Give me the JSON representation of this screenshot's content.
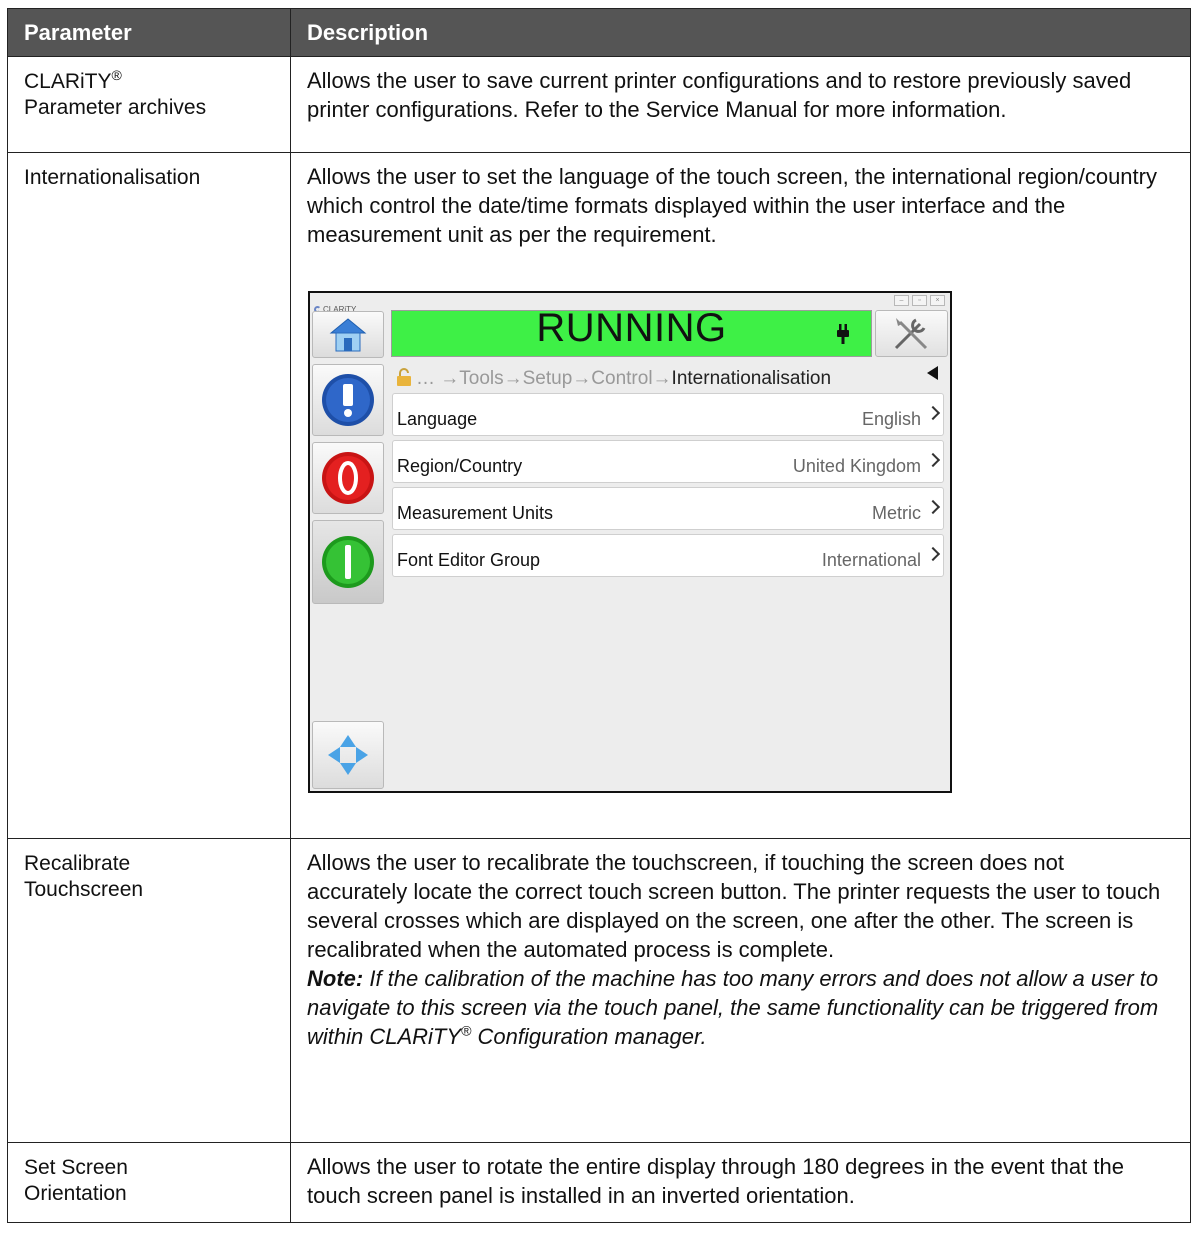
{
  "table": {
    "headers": [
      "Parameter",
      "Description"
    ],
    "rows": {
      "archives": {
        "param_line1": "CLARiTY",
        "param_sup": "®",
        "param_line2": "Parameter archives",
        "desc": "Allows the user to save current printer configurations and to restore previously saved printer configurations. Refer to the Service Manual for more information."
      },
      "intl": {
        "param": "Internationalisation",
        "desc": "Allows the user to set the language of the touch screen, the international region/country which control the date/time formats displayed within the user interface and the measurement unit as per the requirement."
      },
      "recal": {
        "param_line1": "Recalibrate",
        "param_line2": "Touchscreen",
        "desc": "Allows the user to recalibrate the touchscreen, if touching the screen does not accurately locate the correct touch screen button. The printer requests the user to touch several crosses which are displayed on the screen, one after the other. The screen is recalibrated when the automated process is complete.",
        "note_label": "Note:",
        "note_text": " If the calibration of the machine has too many errors and does not allow a user to navigate to this screen via the touch panel, the same functionality can be triggered from within CLARiTY",
        "note_sup": "®",
        "note_end": " Configuration manager."
      },
      "orient": {
        "param_line1": "Set Screen",
        "param_line2": "Orientation",
        "desc": "Allows the user to rotate the entire display through 180 degrees in the event that the touch screen panel is installed in an inverted orientation."
      }
    }
  },
  "screenshot": {
    "app_name": "CLARiTY",
    "status": "RUNNING",
    "status_color": "#3ef046",
    "breadcrumb_path": "… →Tools→Setup→Control→",
    "breadcrumb_current": "Internationalisation",
    "settings": [
      {
        "label": "Language",
        "value": "English"
      },
      {
        "label": "Region/Country",
        "value": "United Kingdom"
      },
      {
        "label": "Measurement Units",
        "value": "Metric"
      },
      {
        "label": "Font Editor Group",
        "value": "International"
      }
    ],
    "icons": [
      "home-icon",
      "info-icon",
      "stop-icon",
      "start-icon",
      "navigate-arrows-icon",
      "tools-icon",
      "plug-icon",
      "lock-icon"
    ]
  }
}
